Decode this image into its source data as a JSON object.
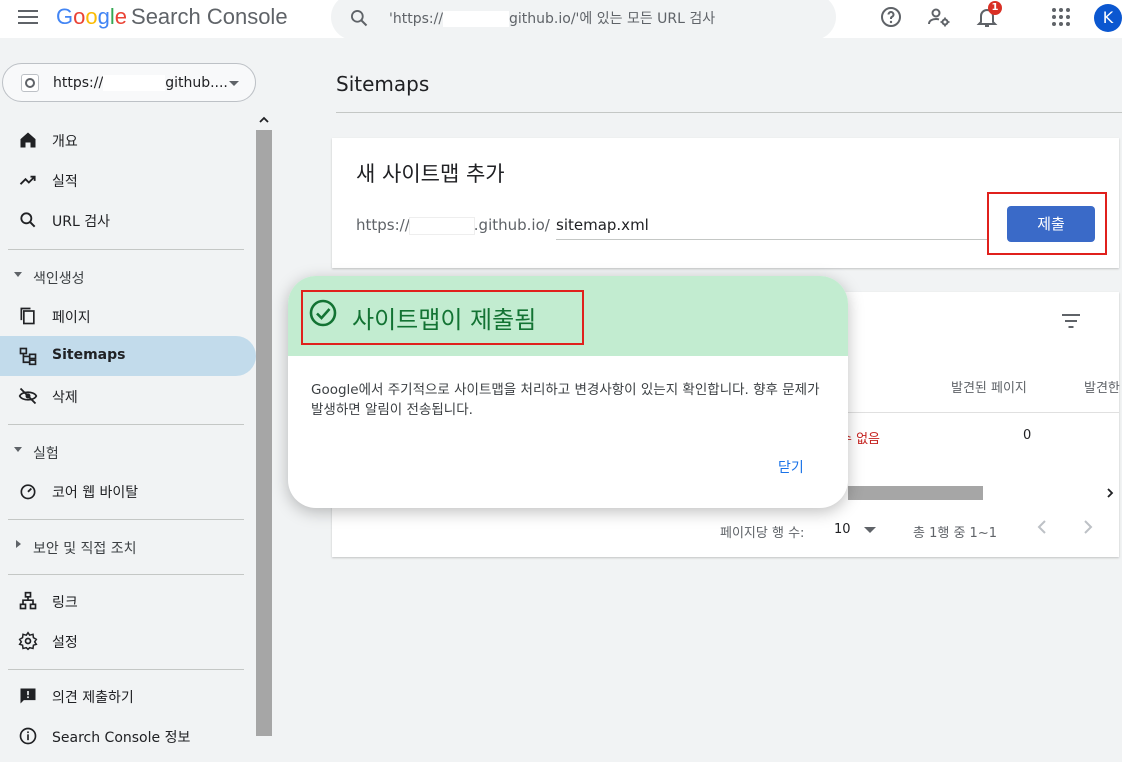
{
  "topbar": {
    "logo_google": [
      "G",
      "o",
      "o",
      "g",
      "l",
      "e"
    ],
    "logo_product": "Search Console",
    "search_prefix": "'https://",
    "search_suffix": "github.io/'에 있는 모든 URL 검사",
    "notification_count": "1",
    "avatar_letter": "K",
    "icons": [
      "menu-icon",
      "search-icon",
      "help-icon",
      "manage-users-icon",
      "bell-icon",
      "apps-icon"
    ]
  },
  "property": {
    "prefix": "https://",
    "suffix": "github...."
  },
  "sidebar": {
    "items": [
      {
        "label": "개요",
        "icon": "home-icon"
      },
      {
        "label": "실적",
        "icon": "trending-up-icon"
      },
      {
        "label": "URL 검사",
        "icon": "search-icon"
      }
    ],
    "section_index": {
      "label": "색인생성",
      "items": [
        {
          "label": "페이지",
          "icon": "pages-icon"
        },
        {
          "label": "Sitemaps",
          "icon": "sitemap-icon",
          "active": true
        },
        {
          "label": "삭제",
          "icon": "visibility-off-icon"
        }
      ]
    },
    "section_experiment": {
      "label": "실험",
      "items": [
        {
          "label": "코어 웹 바이탈",
          "icon": "speed-icon"
        }
      ]
    },
    "section_security": {
      "label": "보안 및 직접 조치"
    },
    "items2": [
      {
        "label": "링크",
        "icon": "links-icon"
      },
      {
        "label": "설정",
        "icon": "settings-icon"
      }
    ],
    "items3": [
      {
        "label": "의견 제출하기",
        "icon": "feedback-icon"
      },
      {
        "label": "Search Console 정보",
        "icon": "info-icon"
      }
    ]
  },
  "main": {
    "title": "Sitemaps",
    "add_card": {
      "title": "새 사이트맵 추가",
      "url_prefix_start": "https://",
      "url_prefix_end": ".github.io/",
      "input_value": "sitemap.xml",
      "submit_label": "제출"
    },
    "table": {
      "columns": [
        "발견된 페이지",
        "발견한"
      ],
      "rows": [
        {
          "status": "수 없음",
          "pages": "0"
        }
      ],
      "rows_per_page_label": "페이지당 행 수:",
      "rows_per_page_value": "10",
      "range_label": "총 1행 중 1~1"
    }
  },
  "dialog": {
    "title": "사이트맵이 제출됨",
    "body": "Google에서 주기적으로 사이트맵을 처리하고 변경사항이 있는지 확인합니다. 향후 문제가 발생하면 알림이 전송됩니다.",
    "close_label": "닫기"
  },
  "colors": {
    "accent": "#3a6ac8",
    "active_nav": "#c2dbeb",
    "dialog_header": "#c2ecd0",
    "success_text": "#137333",
    "annotation_red": "#e0201c",
    "error_text": "#c5221f"
  }
}
